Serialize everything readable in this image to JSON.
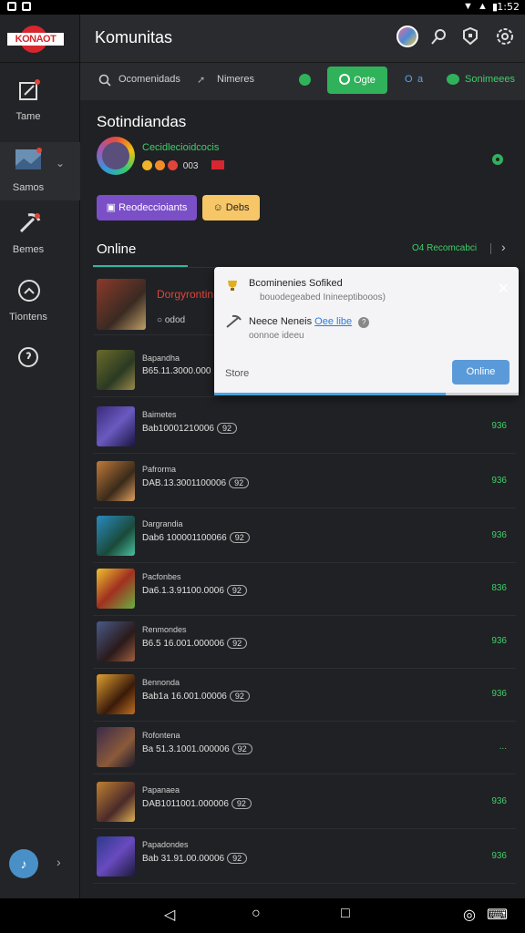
{
  "status_bar": {
    "time": "1:52"
  },
  "sidebar": {
    "brand": "KONAOT",
    "items": [
      {
        "label": "Tame",
        "icon": "edit-icon"
      },
      {
        "label": "Samos",
        "icon": "image-icon"
      },
      {
        "label": "Bemes",
        "icon": "pickaxe-icon"
      },
      {
        "label": "Tiontens",
        "icon": "chat-bubble-icon"
      },
      {
        "label": "",
        "icon": "help-icon"
      }
    ],
    "bottom_icon": "♪"
  },
  "topbar": {
    "title": "Komunitas"
  },
  "filterbar": {
    "search_label": "Ocomenidads",
    "second_label": "Nimeres",
    "green_btn": "Ogte",
    "q_label": "a",
    "last_label": "Sonimeees"
  },
  "profile": {
    "section_title": "Sotindiandas",
    "name": "Cecidlecioidcocis",
    "coins": "003",
    "btn_purple": "Reodeccioiants",
    "btn_yellow": "Debs"
  },
  "tabs": {
    "online_label": "Online",
    "right_count": "O4 Recomcabci"
  },
  "rows": {
    "first": {
      "name": "Dorgyrontin",
      "sub": "odod"
    },
    "items": [
      {
        "name": "Bapandha",
        "sub": "B65.11.3000.000"
      },
      {
        "name": "Baimetes",
        "sub": "Bab10001210006",
        "pill": "92",
        "stat": "936"
      },
      {
        "name": "Pafrorma",
        "sub": "DAB.13.3001100006",
        "pill": "92",
        "stat": "936"
      },
      {
        "name": "Dargrandia",
        "sub": "Dab6 100001100066",
        "pill": "92",
        "stat": "936"
      },
      {
        "name": "Pacfonbes",
        "sub": "Da6.1.3.91100.0006",
        "pill": "92",
        "stat": "836"
      },
      {
        "name": "Renmondes",
        "sub": "B6.5 16.001.000006",
        "pill": "92",
        "stat": "936"
      },
      {
        "name": "Bennonda",
        "sub": "Bab1a 16.001.00006",
        "pill": "92",
        "stat": "936"
      },
      {
        "name": "Rofontena",
        "sub": "Ba 51.3.1001.000006",
        "pill": "92",
        "stat": "..."
      },
      {
        "name": "Papanaea",
        "sub": "DAB1011001.000006",
        "pill": "92",
        "stat": "936"
      },
      {
        "name": "Papadondes",
        "sub": "Bab 31.91.00.00006",
        "pill": "92",
        "stat": "936"
      }
    ]
  },
  "popup": {
    "line1": "Bcominenies Sofiked",
    "line1_sub": "bouodegeabed Inineeptibooos)",
    "line2": "Neece Neneis",
    "line2_link": "Oee libe",
    "line2_sub": "oonnoe ideeu",
    "store": "Store",
    "btn": "Online",
    "progress": 0.76
  }
}
